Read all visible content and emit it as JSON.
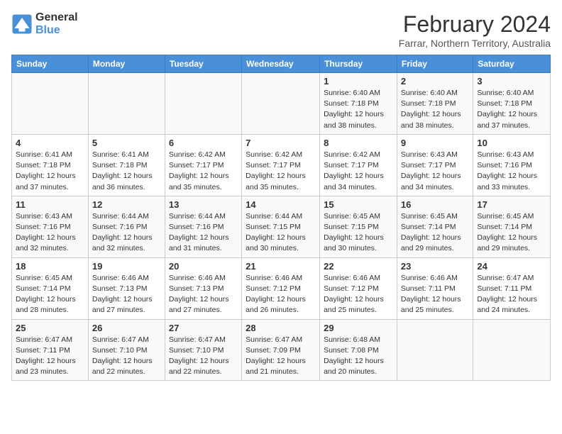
{
  "header": {
    "logo_line1": "General",
    "logo_line2": "Blue",
    "month_title": "February 2024",
    "subtitle": "Farrar, Northern Territory, Australia"
  },
  "weekdays": [
    "Sunday",
    "Monday",
    "Tuesday",
    "Wednesday",
    "Thursday",
    "Friday",
    "Saturday"
  ],
  "weeks": [
    [
      {
        "day": "",
        "sunrise": "",
        "sunset": "",
        "daylight": ""
      },
      {
        "day": "",
        "sunrise": "",
        "sunset": "",
        "daylight": ""
      },
      {
        "day": "",
        "sunrise": "",
        "sunset": "",
        "daylight": ""
      },
      {
        "day": "",
        "sunrise": "",
        "sunset": "",
        "daylight": ""
      },
      {
        "day": "1",
        "sunrise": "Sunrise: 6:40 AM",
        "sunset": "Sunset: 7:18 PM",
        "daylight": "Daylight: 12 hours and 38 minutes."
      },
      {
        "day": "2",
        "sunrise": "Sunrise: 6:40 AM",
        "sunset": "Sunset: 7:18 PM",
        "daylight": "Daylight: 12 hours and 38 minutes."
      },
      {
        "day": "3",
        "sunrise": "Sunrise: 6:40 AM",
        "sunset": "Sunset: 7:18 PM",
        "daylight": "Daylight: 12 hours and 37 minutes."
      }
    ],
    [
      {
        "day": "4",
        "sunrise": "Sunrise: 6:41 AM",
        "sunset": "Sunset: 7:18 PM",
        "daylight": "Daylight: 12 hours and 37 minutes."
      },
      {
        "day": "5",
        "sunrise": "Sunrise: 6:41 AM",
        "sunset": "Sunset: 7:18 PM",
        "daylight": "Daylight: 12 hours and 36 minutes."
      },
      {
        "day": "6",
        "sunrise": "Sunrise: 6:42 AM",
        "sunset": "Sunset: 7:17 PM",
        "daylight": "Daylight: 12 hours and 35 minutes."
      },
      {
        "day": "7",
        "sunrise": "Sunrise: 6:42 AM",
        "sunset": "Sunset: 7:17 PM",
        "daylight": "Daylight: 12 hours and 35 minutes."
      },
      {
        "day": "8",
        "sunrise": "Sunrise: 6:42 AM",
        "sunset": "Sunset: 7:17 PM",
        "daylight": "Daylight: 12 hours and 34 minutes."
      },
      {
        "day": "9",
        "sunrise": "Sunrise: 6:43 AM",
        "sunset": "Sunset: 7:17 PM",
        "daylight": "Daylight: 12 hours and 34 minutes."
      },
      {
        "day": "10",
        "sunrise": "Sunrise: 6:43 AM",
        "sunset": "Sunset: 7:16 PM",
        "daylight": "Daylight: 12 hours and 33 minutes."
      }
    ],
    [
      {
        "day": "11",
        "sunrise": "Sunrise: 6:43 AM",
        "sunset": "Sunset: 7:16 PM",
        "daylight": "Daylight: 12 hours and 32 minutes."
      },
      {
        "day": "12",
        "sunrise": "Sunrise: 6:44 AM",
        "sunset": "Sunset: 7:16 PM",
        "daylight": "Daylight: 12 hours and 32 minutes."
      },
      {
        "day": "13",
        "sunrise": "Sunrise: 6:44 AM",
        "sunset": "Sunset: 7:16 PM",
        "daylight": "Daylight: 12 hours and 31 minutes."
      },
      {
        "day": "14",
        "sunrise": "Sunrise: 6:44 AM",
        "sunset": "Sunset: 7:15 PM",
        "daylight": "Daylight: 12 hours and 30 minutes."
      },
      {
        "day": "15",
        "sunrise": "Sunrise: 6:45 AM",
        "sunset": "Sunset: 7:15 PM",
        "daylight": "Daylight: 12 hours and 30 minutes."
      },
      {
        "day": "16",
        "sunrise": "Sunrise: 6:45 AM",
        "sunset": "Sunset: 7:14 PM",
        "daylight": "Daylight: 12 hours and 29 minutes."
      },
      {
        "day": "17",
        "sunrise": "Sunrise: 6:45 AM",
        "sunset": "Sunset: 7:14 PM",
        "daylight": "Daylight: 12 hours and 29 minutes."
      }
    ],
    [
      {
        "day": "18",
        "sunrise": "Sunrise: 6:45 AM",
        "sunset": "Sunset: 7:14 PM",
        "daylight": "Daylight: 12 hours and 28 minutes."
      },
      {
        "day": "19",
        "sunrise": "Sunrise: 6:46 AM",
        "sunset": "Sunset: 7:13 PM",
        "daylight": "Daylight: 12 hours and 27 minutes."
      },
      {
        "day": "20",
        "sunrise": "Sunrise: 6:46 AM",
        "sunset": "Sunset: 7:13 PM",
        "daylight": "Daylight: 12 hours and 27 minutes."
      },
      {
        "day": "21",
        "sunrise": "Sunrise: 6:46 AM",
        "sunset": "Sunset: 7:12 PM",
        "daylight": "Daylight: 12 hours and 26 minutes."
      },
      {
        "day": "22",
        "sunrise": "Sunrise: 6:46 AM",
        "sunset": "Sunset: 7:12 PM",
        "daylight": "Daylight: 12 hours and 25 minutes."
      },
      {
        "day": "23",
        "sunrise": "Sunrise: 6:46 AM",
        "sunset": "Sunset: 7:11 PM",
        "daylight": "Daylight: 12 hours and 25 minutes."
      },
      {
        "day": "24",
        "sunrise": "Sunrise: 6:47 AM",
        "sunset": "Sunset: 7:11 PM",
        "daylight": "Daylight: 12 hours and 24 minutes."
      }
    ],
    [
      {
        "day": "25",
        "sunrise": "Sunrise: 6:47 AM",
        "sunset": "Sunset: 7:11 PM",
        "daylight": "Daylight: 12 hours and 23 minutes."
      },
      {
        "day": "26",
        "sunrise": "Sunrise: 6:47 AM",
        "sunset": "Sunset: 7:10 PM",
        "daylight": "Daylight: 12 hours and 22 minutes."
      },
      {
        "day": "27",
        "sunrise": "Sunrise: 6:47 AM",
        "sunset": "Sunset: 7:10 PM",
        "daylight": "Daylight: 12 hours and 22 minutes."
      },
      {
        "day": "28",
        "sunrise": "Sunrise: 6:47 AM",
        "sunset": "Sunset: 7:09 PM",
        "daylight": "Daylight: 12 hours and 21 minutes."
      },
      {
        "day": "29",
        "sunrise": "Sunrise: 6:48 AM",
        "sunset": "Sunset: 7:08 PM",
        "daylight": "Daylight: 12 hours and 20 minutes."
      },
      {
        "day": "",
        "sunrise": "",
        "sunset": "",
        "daylight": ""
      },
      {
        "day": "",
        "sunrise": "",
        "sunset": "",
        "daylight": ""
      }
    ]
  ]
}
